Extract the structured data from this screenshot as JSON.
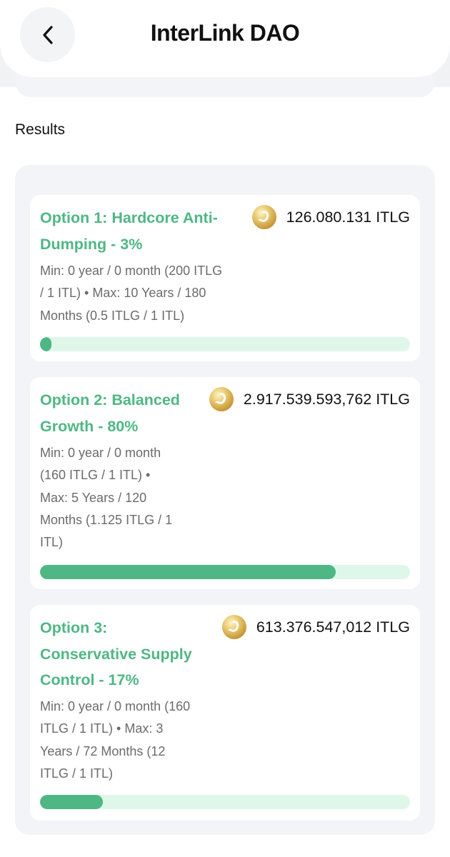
{
  "header": {
    "title": "InterLink DAO",
    "back_icon": "chevron-left-icon"
  },
  "results": {
    "heading": "Results",
    "token_icon": "itlg-coin-icon",
    "colors": {
      "accent": "#4fb784",
      "track": "#dff7e9",
      "panel": "#f3f4f8"
    },
    "options": [
      {
        "title_line1": "Option 1: Hardcore Anti-",
        "title_line2": "Dumping - 3%",
        "title_line3": "",
        "amount": "126.080.131 ITLG",
        "desc_line1": "Min: 0 year / 0 month (200 ITLG",
        "desc_line2": "/ 1 ITL) • Max: 10 Years / 180",
        "desc_line3": "Months (0.5 ITLG / 1 ITL)",
        "desc_line4": "",
        "desc_line5": "",
        "percent": 3
      },
      {
        "title_line1": "Option 2: Balanced",
        "title_line2": "Growth - 80%",
        "title_line3": "",
        "amount": "2.917.539.593,762 ITLG",
        "desc_line1": "Min: 0 year / 0 month",
        "desc_line2": "(160 ITLG / 1 ITL) •",
        "desc_line3": "Max: 5 Years / 120",
        "desc_line4": "Months (1.125 ITLG / 1",
        "desc_line5": "ITL)",
        "percent": 80
      },
      {
        "title_line1": "Option 3:",
        "title_line2": "Conservative Supply",
        "title_line3": "Control - 17%",
        "amount": "613.376.547,012 ITLG",
        "desc_line1": "Min: 0 year / 0 month (160",
        "desc_line2": "ITLG / 1 ITL) • Max: 3",
        "desc_line3": "Years / 72 Months (12",
        "desc_line4": "ITLG / 1 ITL)",
        "desc_line5": "",
        "percent": 17
      }
    ]
  }
}
